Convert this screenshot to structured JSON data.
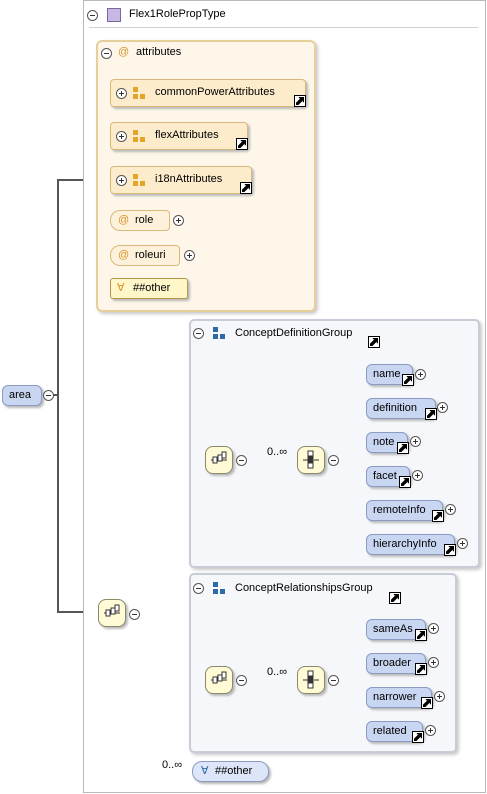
{
  "root_element": {
    "label": "area"
  },
  "complex_type": {
    "label": "Flex1RolePropType"
  },
  "attributes_group": {
    "label": "attributes",
    "attribute_groups": [
      {
        "label": "commonPowerAttributes"
      },
      {
        "label": "flexAttributes"
      },
      {
        "label": "i18nAttributes"
      }
    ],
    "attributes": [
      {
        "label": "role"
      },
      {
        "label": "roleuri"
      }
    ],
    "any_attribute": {
      "label": "##other"
    }
  },
  "groups": [
    {
      "label": "ConceptDefinitionGroup",
      "cardinality": "0..∞",
      "elements": [
        {
          "label": "name"
        },
        {
          "label": "definition"
        },
        {
          "label": "note"
        },
        {
          "label": "facet"
        },
        {
          "label": "remoteInfo"
        },
        {
          "label": "hierarchyInfo"
        }
      ]
    },
    {
      "label": "ConceptRelationshipsGroup",
      "cardinality": "0..∞",
      "elements": [
        {
          "label": "sameAs"
        },
        {
          "label": "broader"
        },
        {
          "label": "narrower"
        },
        {
          "label": "related"
        }
      ]
    }
  ],
  "any_element": {
    "label": "##other",
    "cardinality": "0..∞"
  },
  "colors": {
    "element_fill": "#c9d6f2",
    "attribute_fill": "#fdeccc",
    "compositor_fill": "#fffbd6",
    "group_border": "#c8ccd6",
    "connector": "#555555"
  }
}
